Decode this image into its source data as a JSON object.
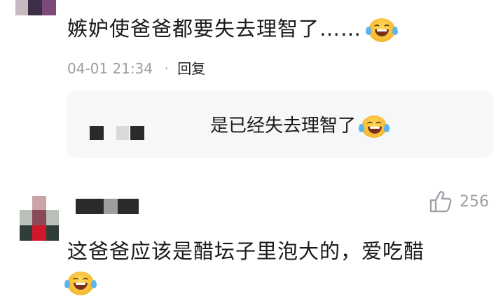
{
  "comment1": {
    "text": "嫉妒使爸爸都要失去理智了……",
    "timestamp": "04-01 21:34",
    "separator": "·",
    "reply_label": "回复"
  },
  "reply": {
    "text": "是已经失去理智了"
  },
  "comment2": {
    "likes": "256",
    "text": "这爸爸应该是醋坛子里泡大的，爱吃醋"
  },
  "icons": [
    "laughing-crying-emoji",
    "thumbs-up-icon",
    "avatar-mosaic"
  ],
  "colors": {
    "meta_gray": "#9aa0a6",
    "reply_bg": "#f6f7f9",
    "text": "#1a1a1a"
  }
}
